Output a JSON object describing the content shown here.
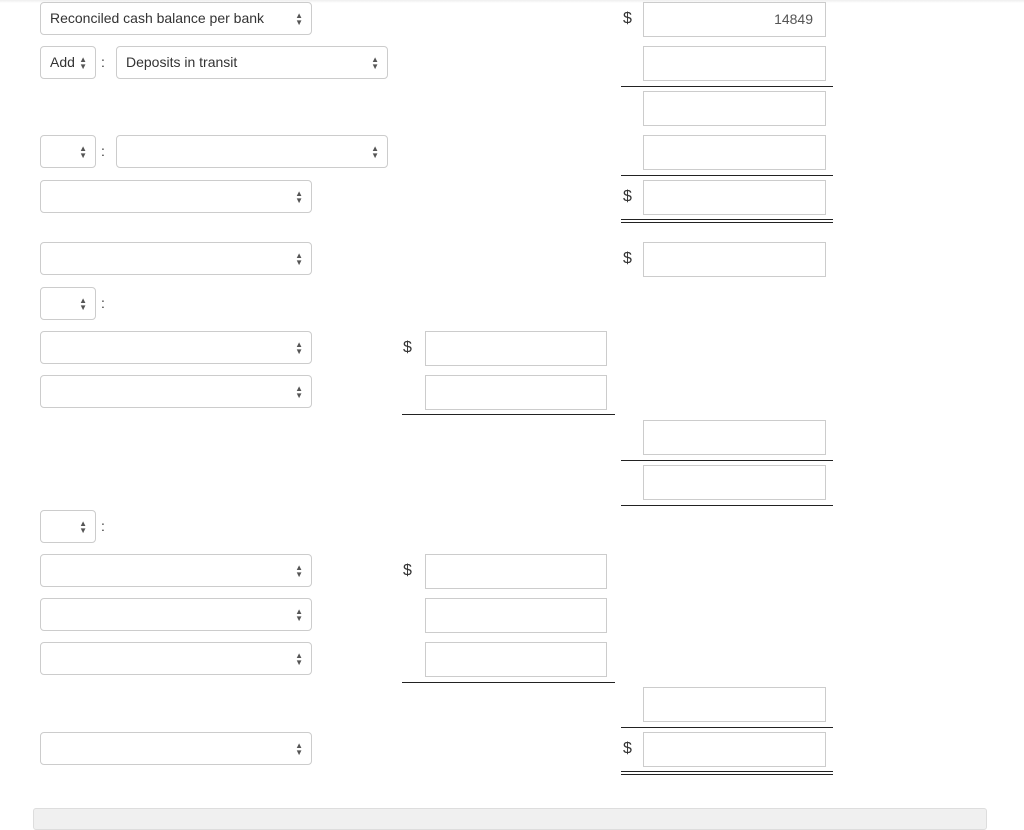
{
  "rows": {
    "r0_label": "Reconciled cash balance per bank",
    "r1_type": "Add",
    "r1_label": "Deposits in transit",
    "colon": ":",
    "currency": "$",
    "r0_amount": "14849"
  }
}
